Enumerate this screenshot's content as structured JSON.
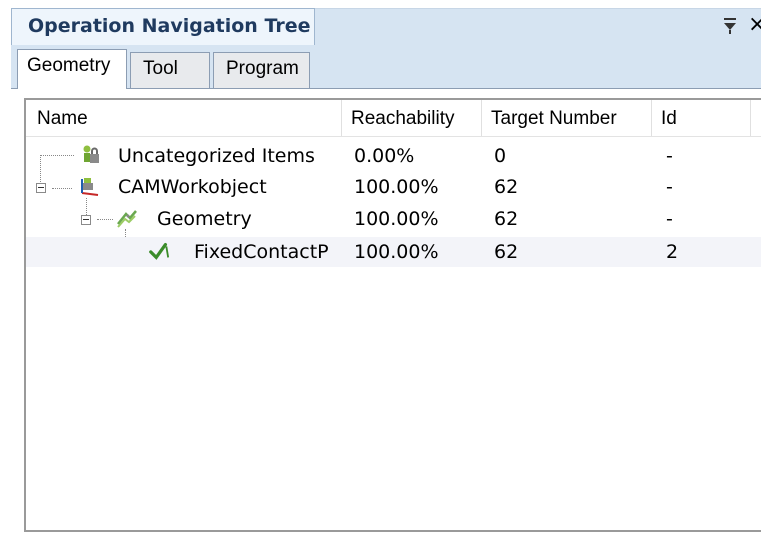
{
  "panel": {
    "title": "Operation Navigation Tree",
    "pin_glyph": "⩡",
    "close_glyph": "×"
  },
  "tabs": [
    {
      "label": "Geometry",
      "selected": true
    },
    {
      "label": "Tool",
      "selected": false
    },
    {
      "label": "Program",
      "selected": false
    }
  ],
  "columns": [
    "Name",
    "Reachability",
    "Target Number",
    "Id"
  ],
  "rows": [
    {
      "name": "Uncategorized Items",
      "reachability": "0.00%",
      "target_number": "0",
      "id": "-",
      "icon": "uncategorized-icon"
    },
    {
      "name": "CAMWorkobject",
      "reachability": "100.00%",
      "target_number": "62",
      "id": "-",
      "icon": "workobject-icon"
    },
    {
      "name": "Geometry",
      "reachability": "100.00%",
      "target_number": "62",
      "id": "-",
      "icon": "geometry-icon"
    },
    {
      "name": "FixedContactP",
      "reachability": "100.00%",
      "target_number": "62",
      "id": "2",
      "icon": "fixed-contact-icon",
      "selected": true
    }
  ]
}
